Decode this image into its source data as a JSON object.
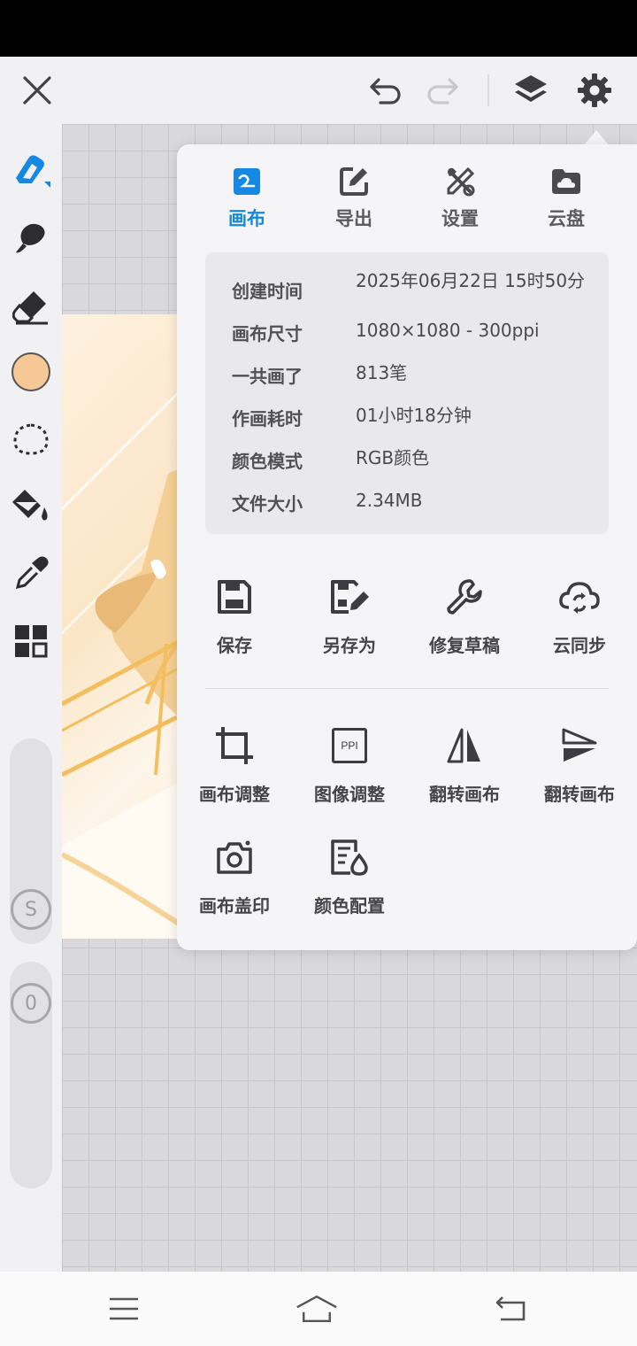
{
  "colors": {
    "accent": "#1688e2",
    "current_color": "#f5c896",
    "icon_gray": "#555555"
  },
  "top_bar": {
    "icons": [
      "close-icon",
      "undo-icon",
      "redo-icon",
      "layers-icon",
      "gear-icon"
    ]
  },
  "left_toolbar": {
    "icons": [
      "brush-icon",
      "smudge-icon",
      "eraser-icon",
      "color-swatch",
      "lasso-icon",
      "bucket-icon",
      "eyedropper-icon",
      "grid-icon"
    ],
    "size_label": "S",
    "opacity_label": "0"
  },
  "panel": {
    "tabs": [
      {
        "label": "画布",
        "icon": "canvas-icon"
      },
      {
        "label": "导出",
        "icon": "export-icon"
      },
      {
        "label": "设置",
        "icon": "tools-icon"
      },
      {
        "label": "云盘",
        "icon": "cloud-folder-icon"
      }
    ],
    "info": [
      {
        "label": "创建时间",
        "value": "2025年06月22日 15时50分"
      },
      {
        "label": "画布尺寸",
        "value": "1080×1080 - 300ppi"
      },
      {
        "label": "一共画了",
        "value": "813笔"
      },
      {
        "label": "作画耗时",
        "value": "01小时18分钟"
      },
      {
        "label": "颜色模式",
        "value": "RGB颜色"
      },
      {
        "label": "文件大小",
        "value": "2.34MB"
      }
    ],
    "actions_row1": [
      {
        "label": "保存",
        "icon": "save-icon"
      },
      {
        "label": "另存为",
        "icon": "save-as-icon"
      },
      {
        "label": "修复草稿",
        "icon": "wrench-icon"
      },
      {
        "label": "云同步",
        "icon": "cloud-sync-icon"
      }
    ],
    "actions_row2": [
      {
        "label": "画布调整",
        "icon": "crop-icon"
      },
      {
        "label": "图像调整",
        "icon": "ppi-icon",
        "icon_text": "PPI"
      },
      {
        "label": "翻转画布",
        "icon": "flip-horizontal-icon"
      },
      {
        "label": "翻转画布",
        "icon": "flip-vertical-icon"
      }
    ],
    "actions_row3": [
      {
        "label": "画布盖印",
        "icon": "camera-icon"
      },
      {
        "label": "颜色配置",
        "icon": "color-profile-icon"
      }
    ]
  },
  "nav_bar": {
    "icons": [
      "menu-icon",
      "home-icon",
      "back-icon"
    ]
  }
}
